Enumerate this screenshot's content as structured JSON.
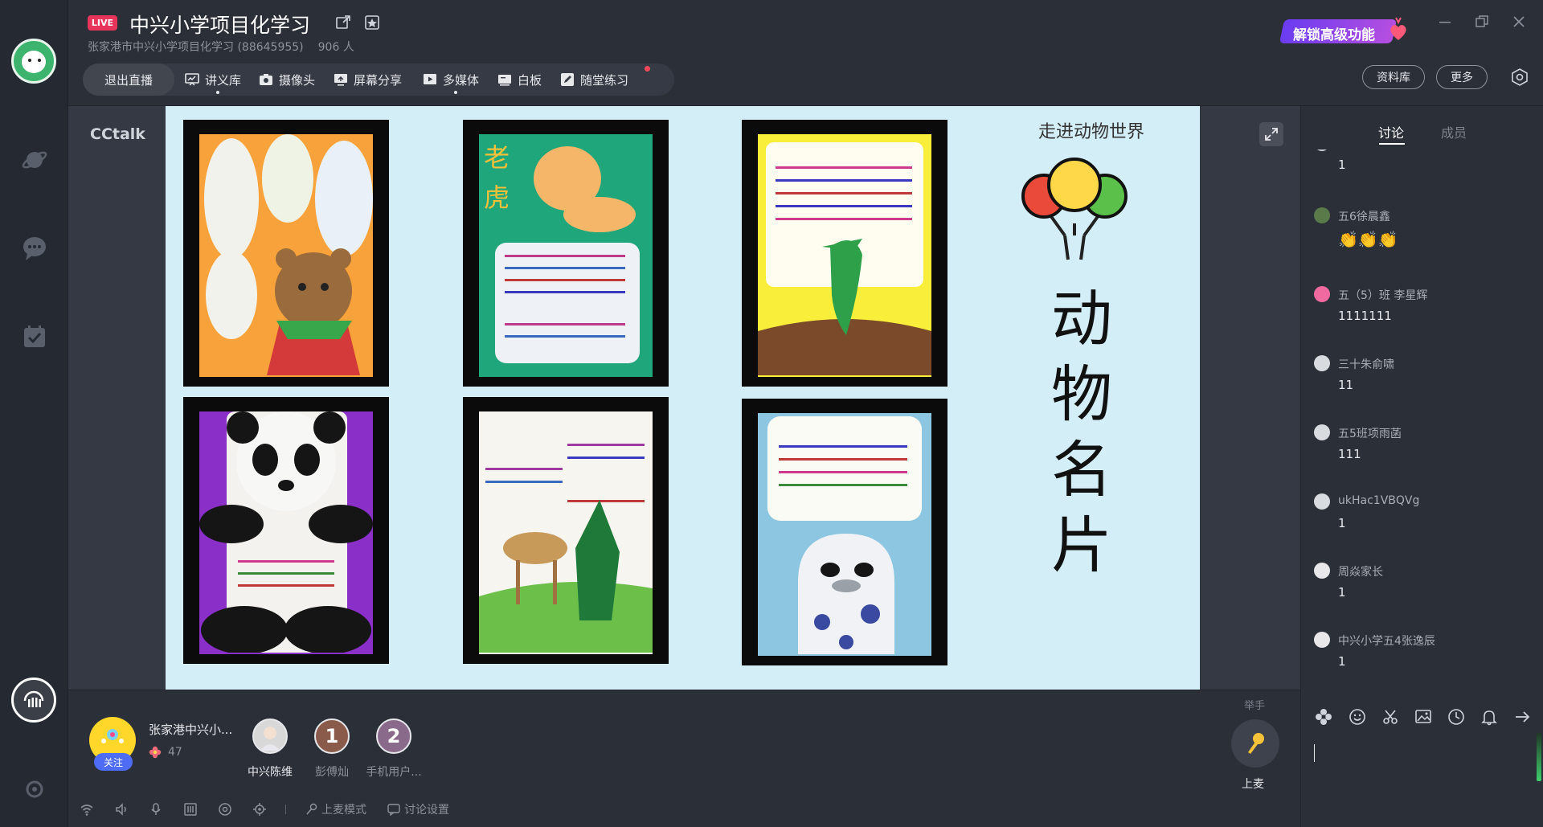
{
  "header": {
    "live_badge": "LIVE",
    "title": "中兴小学项目化学习",
    "subtitle": "张家港市中兴小学项目化学习 (88645955)",
    "viewer_count": "906 人",
    "promo_label": "解锁高级功能",
    "library_button": "资料库",
    "more_button": "更多"
  },
  "toolbar": {
    "exit_label": "退出直播",
    "items": [
      {
        "label": "讲义库",
        "icon": "slides-icon"
      },
      {
        "label": "摄像头",
        "icon": "camera-icon"
      },
      {
        "label": "屏幕分享",
        "icon": "screen-share-icon"
      },
      {
        "label": "多媒体",
        "icon": "media-play-icon"
      },
      {
        "label": "白板",
        "icon": "whiteboard-icon"
      },
      {
        "label": "随堂练习",
        "icon": "pen-edit-icon"
      }
    ]
  },
  "stage": {
    "brand": "CCtalk",
    "slide_heading": "走进动物世界",
    "slide_title_chars": [
      "动",
      "物",
      "名",
      "片"
    ]
  },
  "bottom": {
    "host_name": "张家港中兴小...",
    "host_likes": "47",
    "follow_label": "关注",
    "members": [
      {
        "name": "中兴陈维",
        "badge": ""
      },
      {
        "name": "彭傅灿",
        "badge": "1"
      },
      {
        "name": "手机用户...",
        "badge": "2"
      }
    ],
    "raise_hand_label": "举手",
    "mic_label": "上麦",
    "mic_mode_label": "上麦模式",
    "discussion_settings_label": "讨论设置"
  },
  "panel": {
    "tabs": [
      "讨论",
      "成员"
    ],
    "messages": [
      {
        "name": "",
        "text": "1"
      },
      {
        "name": "五6徐晨鑫",
        "text": "👏👏👏"
      },
      {
        "name": "五（5）班 李星辉",
        "text": "1111111"
      },
      {
        "name": "三十朱俞啸",
        "text": "11"
      },
      {
        "name": "五5班项雨菡",
        "text": "111"
      },
      {
        "name": "ukHac1VBQVg",
        "text": "1"
      },
      {
        "name": "周焱家长",
        "text": "1"
      },
      {
        "name": "中兴小学五4张逸辰",
        "text": "1"
      }
    ]
  },
  "colors": {
    "accent_live": "#e6345a",
    "follow_blue": "#4e6cf5",
    "slide_bg": "#d3eef7"
  }
}
